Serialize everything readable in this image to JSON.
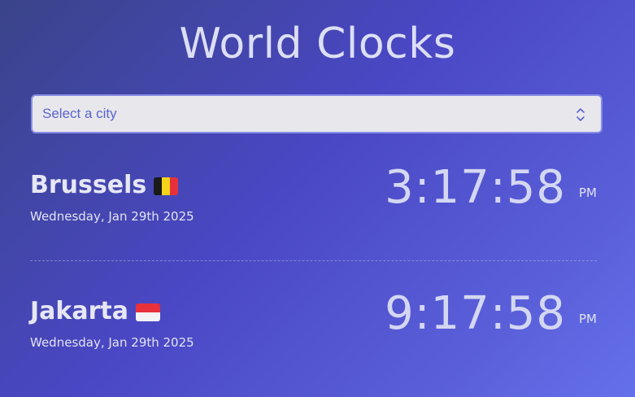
{
  "header": {
    "title": "World Clocks"
  },
  "city_select": {
    "placeholder": "Select a city"
  },
  "clocks": [
    {
      "city": "Brussels",
      "flag": "belgium-flag-icon",
      "date": "Wednesday, Jan 29th 2025",
      "time": "3:17:58",
      "ampm": "PM"
    },
    {
      "city": "Jakarta",
      "flag": "indonesia-flag-icon",
      "date": "Wednesday, Jan 29th 2025",
      "time": "9:17:58",
      "ampm": "PM"
    }
  ],
  "colors": {
    "background_start": "#3a4489",
    "background_end": "#6470ea",
    "select_background": "#e8e8ec",
    "select_border": "#8a8ee6",
    "placeholder_text": "#5a63cf"
  }
}
